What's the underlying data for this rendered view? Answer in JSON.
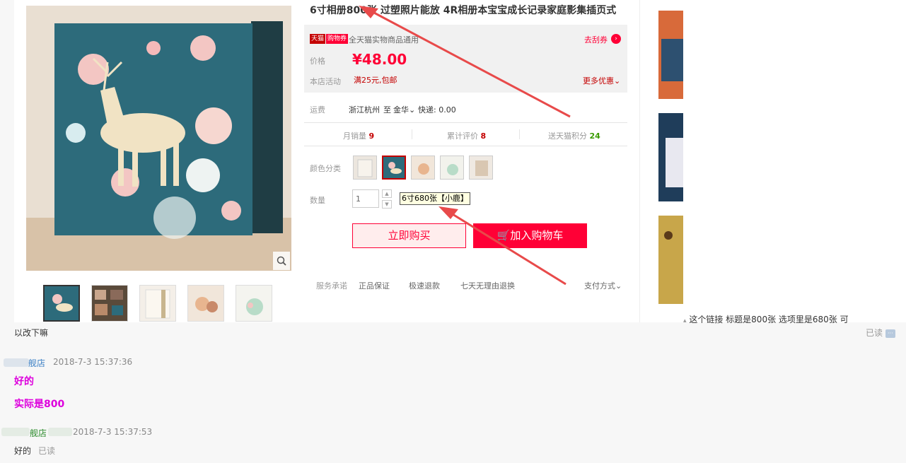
{
  "product": {
    "title": "6寸相册800张 过塑照片能放 4R相册本宝宝成长记录家庭影集插页式",
    "tmall_tag": "天猫",
    "voucher_tag": "购物券",
    "voucher_text": "全天猫实物商品通用",
    "get_coupon": "去刮券",
    "price_label": "价格",
    "price": "¥48.00",
    "promo_label": "本店活动",
    "promo_text": "满25元,包邮",
    "more_deals": "更多优惠",
    "shipping_label": "运费",
    "shipping_from": "浙江杭州",
    "shipping_to_word": "至",
    "shipping_dest": "金华",
    "shipping_method": "快递: 0.00",
    "monthly_sales_label": "月销量",
    "monthly_sales": "9",
    "reviews_label": "累计评价",
    "reviews": "8",
    "points_label": "送天猫积分",
    "points": "24",
    "color_label": "颜色分类",
    "qty_label": "数量",
    "qty_value": "1",
    "qty_tooltip": "6寸680张【小鹿】",
    "buy_now": "立即购买",
    "add_to_cart": "加入购物车",
    "service_label": "服务承诺",
    "service_items": [
      "正品保证",
      "极速退款",
      "七天无理由退换"
    ],
    "payment": "支付方式"
  },
  "chat": {
    "message1_tail": "这个链接 标题是800张 选项里是680张 可",
    "message1_line2": "以改下嘛",
    "read_status1": "已读",
    "reply1_sender": "舰店",
    "reply1_time": "2018-7-3 15:37:36",
    "reply1_line1": "好的",
    "reply1_line2": "实际是800",
    "reply2_sender": "舰店",
    "reply2_time": "2018-7-3 15:37:53",
    "reply2_text": "好的",
    "read_status2": "已读"
  },
  "colors": {
    "tmall_red": "#ff0036",
    "chat_magenta": "#dd00dd",
    "teal": "#2d6b7b"
  }
}
